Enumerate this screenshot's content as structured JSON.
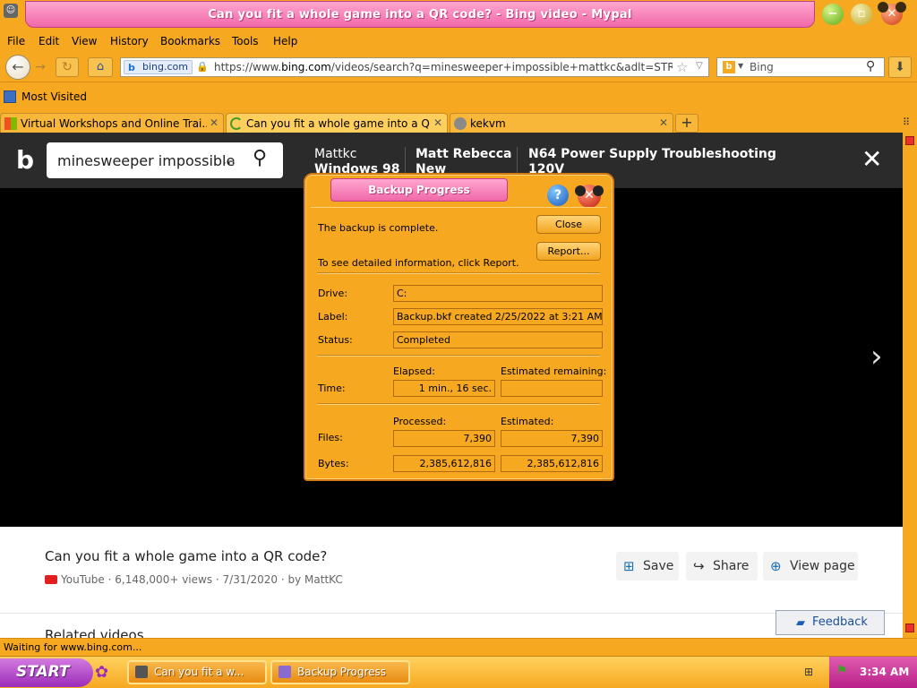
{
  "window": {
    "title": "Can you fit a whole game into a QR code? - Bing video - Mypal",
    "minimize_icon": "minimize-icon",
    "maximize_icon": "maximize-icon",
    "close_icon": "close-icon"
  },
  "menu": [
    "File",
    "Edit",
    "View",
    "History",
    "Bookmarks",
    "Tools",
    "Help"
  ],
  "nav": {
    "site_label": "bing.com",
    "url_prefix": "https://www.",
    "url_domain": "bing.com",
    "url_rest": "/videos/search?q=minesweeper+impossible+mattkc&adlt=STRICT",
    "search_placeholder": "Bing",
    "search_engine_letter": "b"
  },
  "bookmarks": {
    "label": "Most Visited"
  },
  "tabs": [
    {
      "title": "Virtual Workshops and Online Trai...",
      "active": false
    },
    {
      "title": "Can you fit a whole game into a Q...",
      "active": true
    },
    {
      "title": "kekvm",
      "active": false
    }
  ],
  "bing": {
    "search_query": "minesweeper impossible",
    "ellipsis": "...",
    "tab1_line1": "Mattkc",
    "tab1_line2": "Windows 98",
    "tab2_line1": "Matt Rebecca",
    "tab2_line2": "New",
    "tab3_line1": "N64 Power Supply Troubleshooting",
    "tab3_line2": "120V"
  },
  "video": {
    "title": "Can you fit a whole game into a QR code?",
    "source": "YouTube",
    "meta": "· 6,148,000+ views · 7/31/2020 · by MattKC",
    "save_label": "Save",
    "share_label": "Share",
    "view_label": "View page",
    "related_label": "Related videos",
    "feedback_label": "Feedback"
  },
  "dialog": {
    "title": "Backup Progress",
    "complete_text": "The backup is complete.",
    "report_text": "To see detailed information, click Report.",
    "close_btn": "Close",
    "report_btn": "Report...",
    "drive_label": "Drive:",
    "drive_value": "C:",
    "label_label": "Label:",
    "label_value": "Backup.bkf created 2/25/2022 at 3:21 AM",
    "status_label": "Status:",
    "status_value": "Completed",
    "elapsed_header": "Elapsed:",
    "remaining_header": "Estimated remaining:",
    "time_label": "Time:",
    "elapsed_value": "1 min., 16 sec.",
    "remaining_value": "",
    "processed_header": "Processed:",
    "estimated_header": "Estimated:",
    "files_label": "Files:",
    "files_processed": "7,390",
    "files_estimated": "7,390",
    "bytes_label": "Bytes:",
    "bytes_processed": "2,385,612,816",
    "bytes_estimated": "2,385,612,816"
  },
  "status": {
    "text": "Waiting for www.bing.com..."
  },
  "taskbar": {
    "start_label": "START",
    "task1": "Can you fit a w...",
    "task2": "Backup Progress",
    "clock": "3:34 AM"
  }
}
